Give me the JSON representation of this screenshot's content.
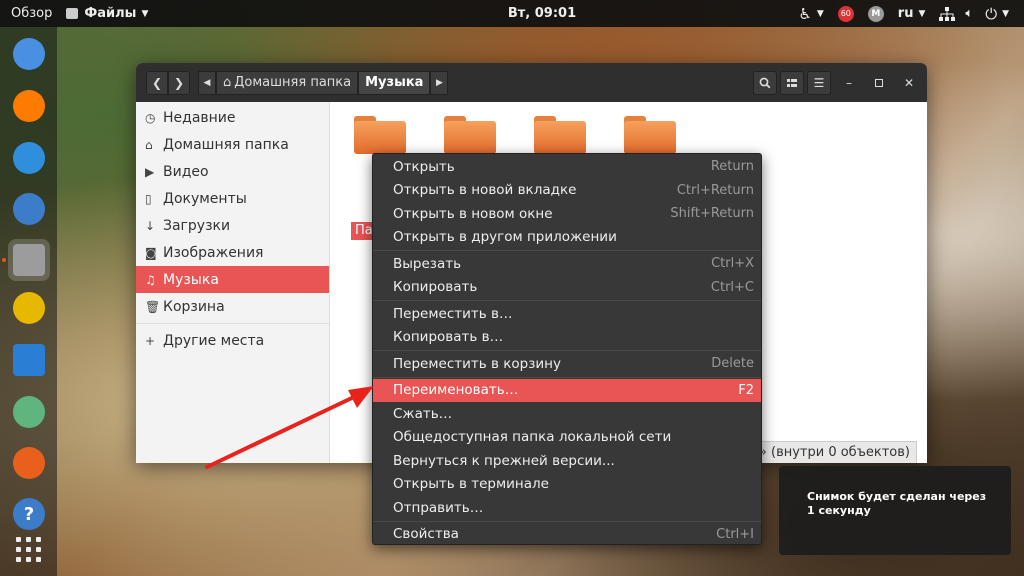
{
  "topbar": {
    "activities": "Обзор",
    "app_menu": "Файлы",
    "clock": "Вт, 09:01",
    "notify_count": "60",
    "m_badge": "M",
    "language": "ru"
  },
  "dock": {
    "apps": [
      {
        "name": "chromium",
        "color": "#4a90e2"
      },
      {
        "name": "firefox",
        "color": "#ff7b00"
      },
      {
        "name": "vscode",
        "color": "#2f8fdc"
      },
      {
        "name": "thunderbird",
        "color": "#3c7cc9"
      },
      {
        "name": "files",
        "color": "#9c9c9c"
      },
      {
        "name": "rhythmbox",
        "color": "#e6b800"
      },
      {
        "name": "writer",
        "color": "#2a7fd4"
      },
      {
        "name": "atom",
        "color": "#5fb57d"
      },
      {
        "name": "software",
        "color": "#e9601c"
      },
      {
        "name": "help",
        "color": "#3c7cc9"
      }
    ],
    "help_glyph": "?"
  },
  "window": {
    "path": [
      "Домашняя папка",
      "Музыка"
    ],
    "sidebar": [
      {
        "icon": "clock",
        "label": "Недавние"
      },
      {
        "icon": "home",
        "label": "Домашняя папка"
      },
      {
        "icon": "video",
        "label": "Видео"
      },
      {
        "icon": "document",
        "label": "Документы"
      },
      {
        "icon": "download",
        "label": "Загрузки"
      },
      {
        "icon": "camera",
        "label": "Изображения"
      },
      {
        "icon": "music",
        "label": "Музыка",
        "selected": true
      },
      {
        "icon": "trash",
        "label": "Корзина"
      },
      {
        "icon": "plus",
        "label": "Другие места"
      }
    ],
    "selected_folder_label": "Па",
    "status_text": "1» (внутри 0 объектов)"
  },
  "context_menu": {
    "groups": [
      [
        {
          "label": "Открыть",
          "accel": "Return"
        },
        {
          "label": "Открыть в новой вкладке",
          "accel": "Ctrl+Return"
        },
        {
          "label": "Открыть в новом окне",
          "accel": "Shift+Return"
        },
        {
          "label": "Открыть в другом приложении",
          "accel": ""
        }
      ],
      [
        {
          "label": "Вырезать",
          "accel": "Ctrl+X"
        },
        {
          "label": "Копировать",
          "accel": "Ctrl+C"
        }
      ],
      [
        {
          "label": "Переместить в…",
          "accel": ""
        },
        {
          "label": "Копировать в…",
          "accel": ""
        }
      ],
      [
        {
          "label": "Переместить в корзину",
          "accel": "Delete"
        }
      ],
      [
        {
          "label": "Переименовать…",
          "accel": "F2",
          "highlighted": true
        },
        {
          "label": "Сжать…",
          "accel": ""
        },
        {
          "label": "Общедоступная папка локальной сети",
          "accel": ""
        },
        {
          "label": "Вернуться к прежней версии...",
          "accel": ""
        },
        {
          "label": "Открыть в терминале",
          "accel": ""
        },
        {
          "label": "Отправить…",
          "accel": ""
        }
      ],
      [
        {
          "label": "Свойства",
          "accel": "Ctrl+I"
        }
      ]
    ]
  },
  "notification": {
    "text": "Снимок будет сделан через 1 секунду"
  },
  "colors": {
    "accent": "#e95454",
    "arrow": "#e8231b"
  }
}
